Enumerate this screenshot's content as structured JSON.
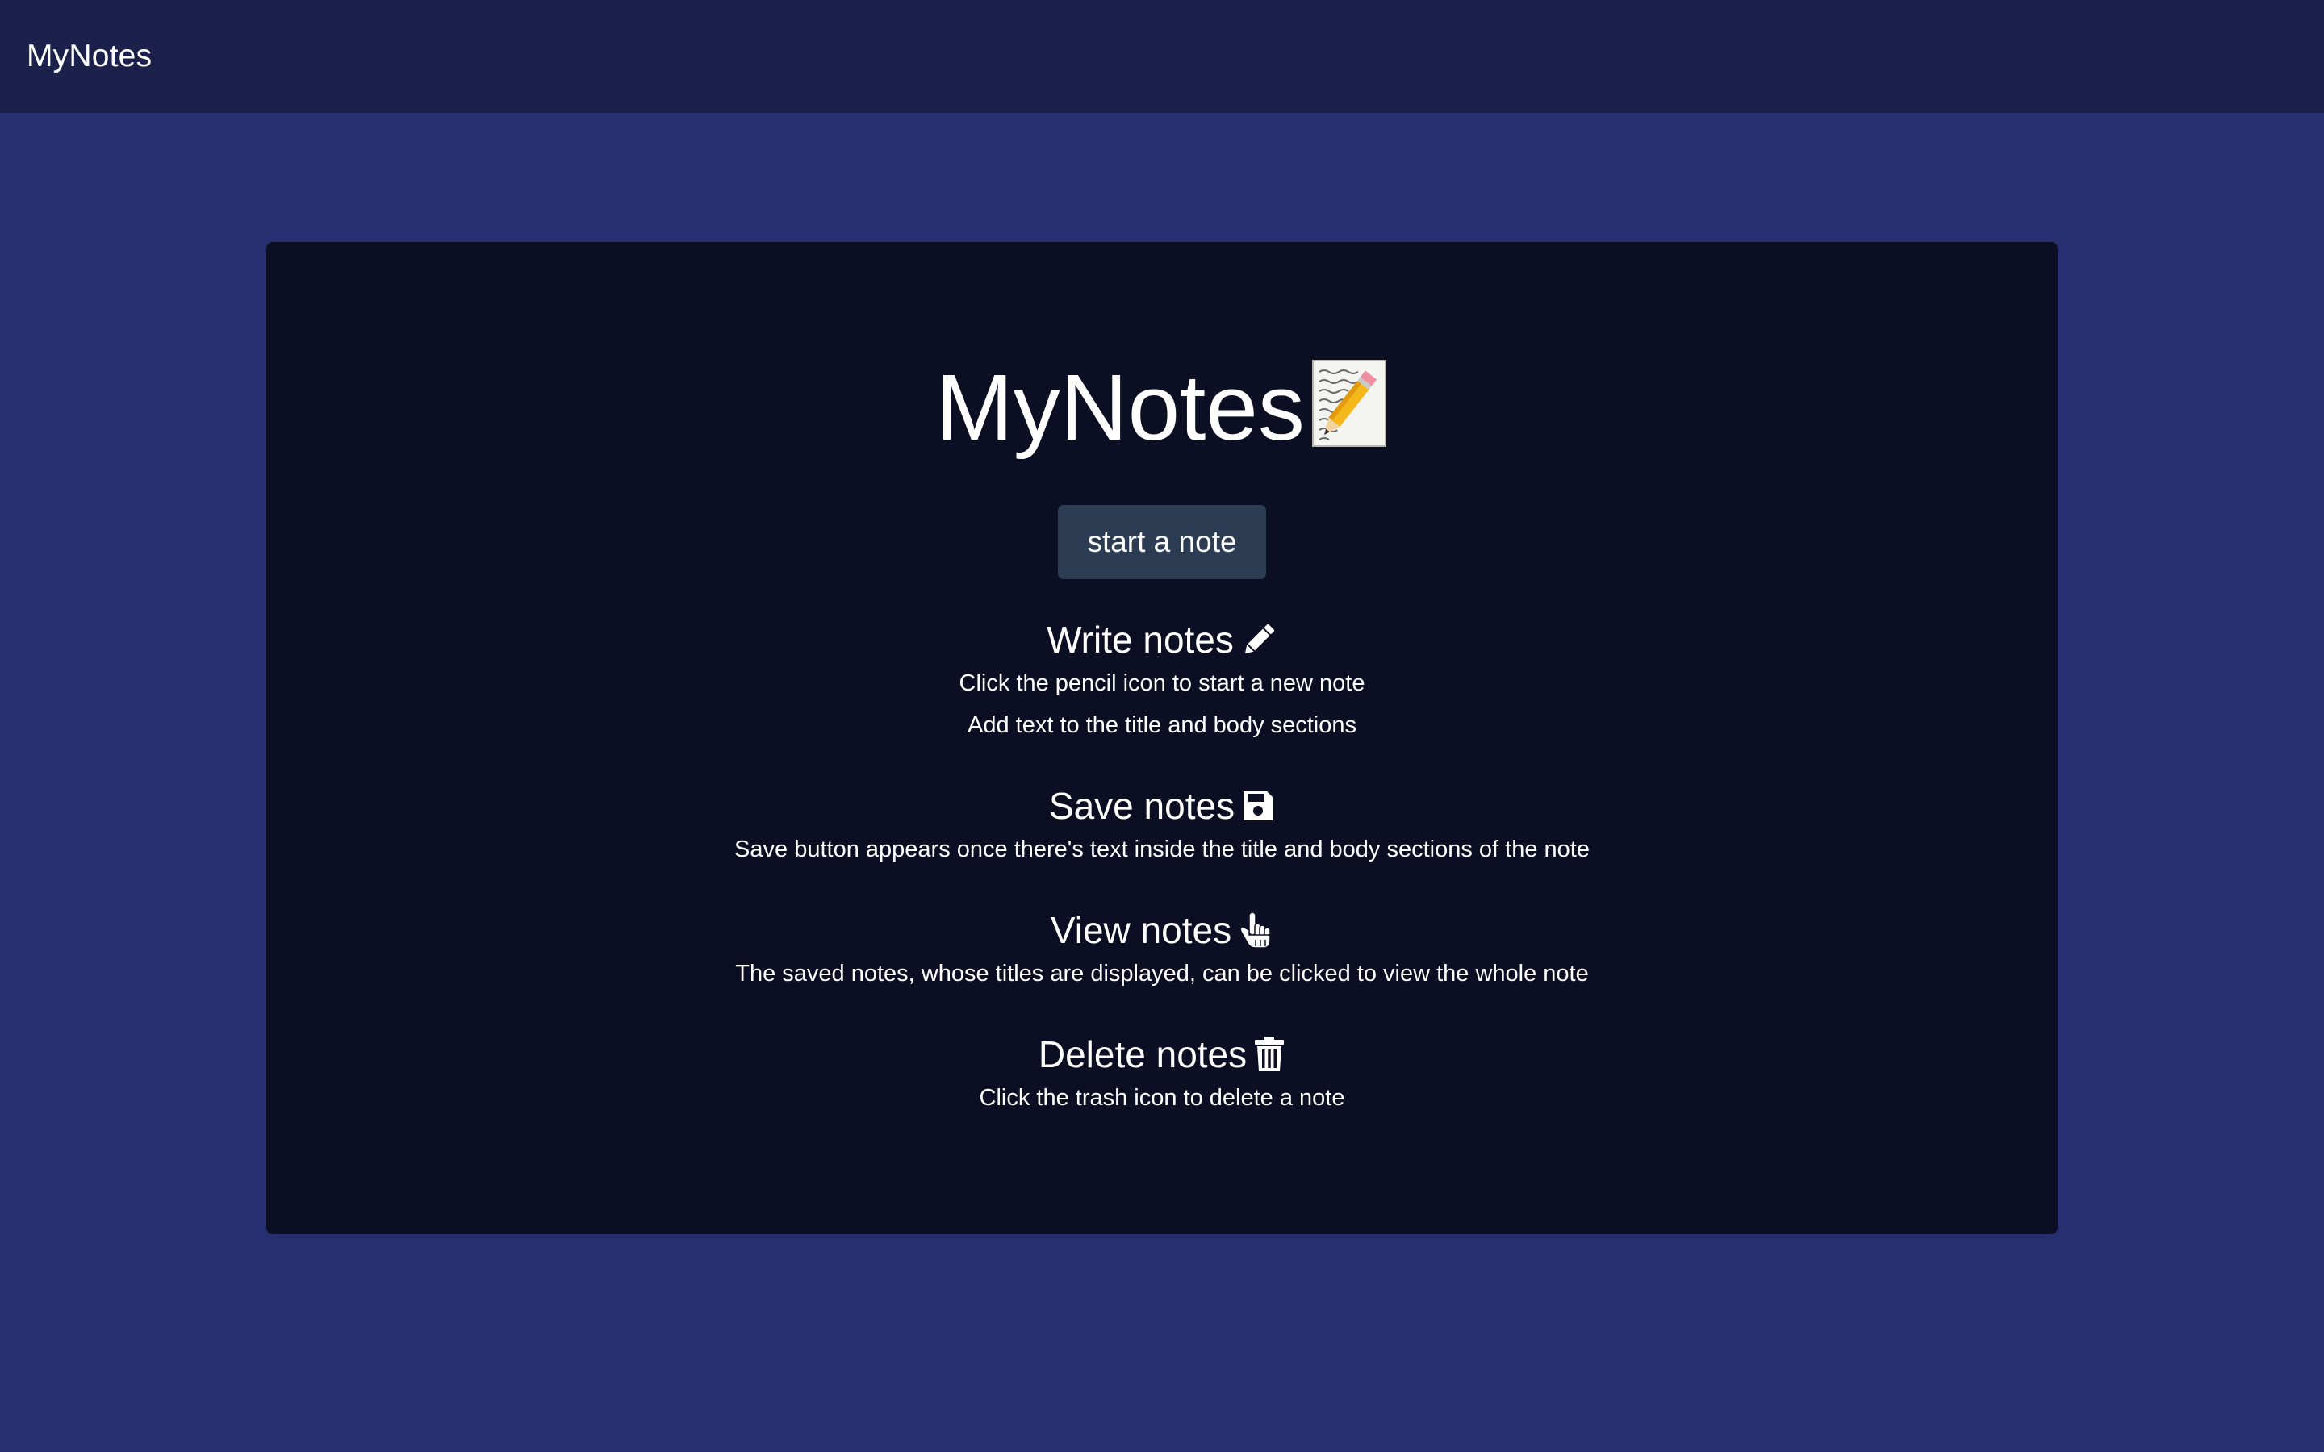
{
  "navbar": {
    "brand": "MyNotes"
  },
  "hero": {
    "title": "MyNotes",
    "icon": "memo-icon"
  },
  "start_button": {
    "label": "start a note"
  },
  "sections": [
    {
      "title": "Write notes",
      "icon": "pencil-icon",
      "lines": [
        "Click the pencil icon to start a new note",
        "Add text to the title and body sections"
      ]
    },
    {
      "title": "Save notes",
      "icon": "floppy-disk-icon",
      "lines": [
        "Save button appears once there's text inside the title and body sections of the note"
      ]
    },
    {
      "title": "View notes",
      "icon": "pointing-hand-icon",
      "lines": [
        "The saved notes, whose titles are displayed, can be clicked to view the whole note"
      ]
    },
    {
      "title": "Delete notes",
      "icon": "trash-icon",
      "lines": [
        "Click the trash icon to delete a note"
      ]
    }
  ],
  "colors": {
    "page_background": "#262f70",
    "navbar_background": "#1c214b",
    "card_background": "#0c0f24",
    "button_background": "#2c3c52",
    "text": "#ffffff"
  }
}
